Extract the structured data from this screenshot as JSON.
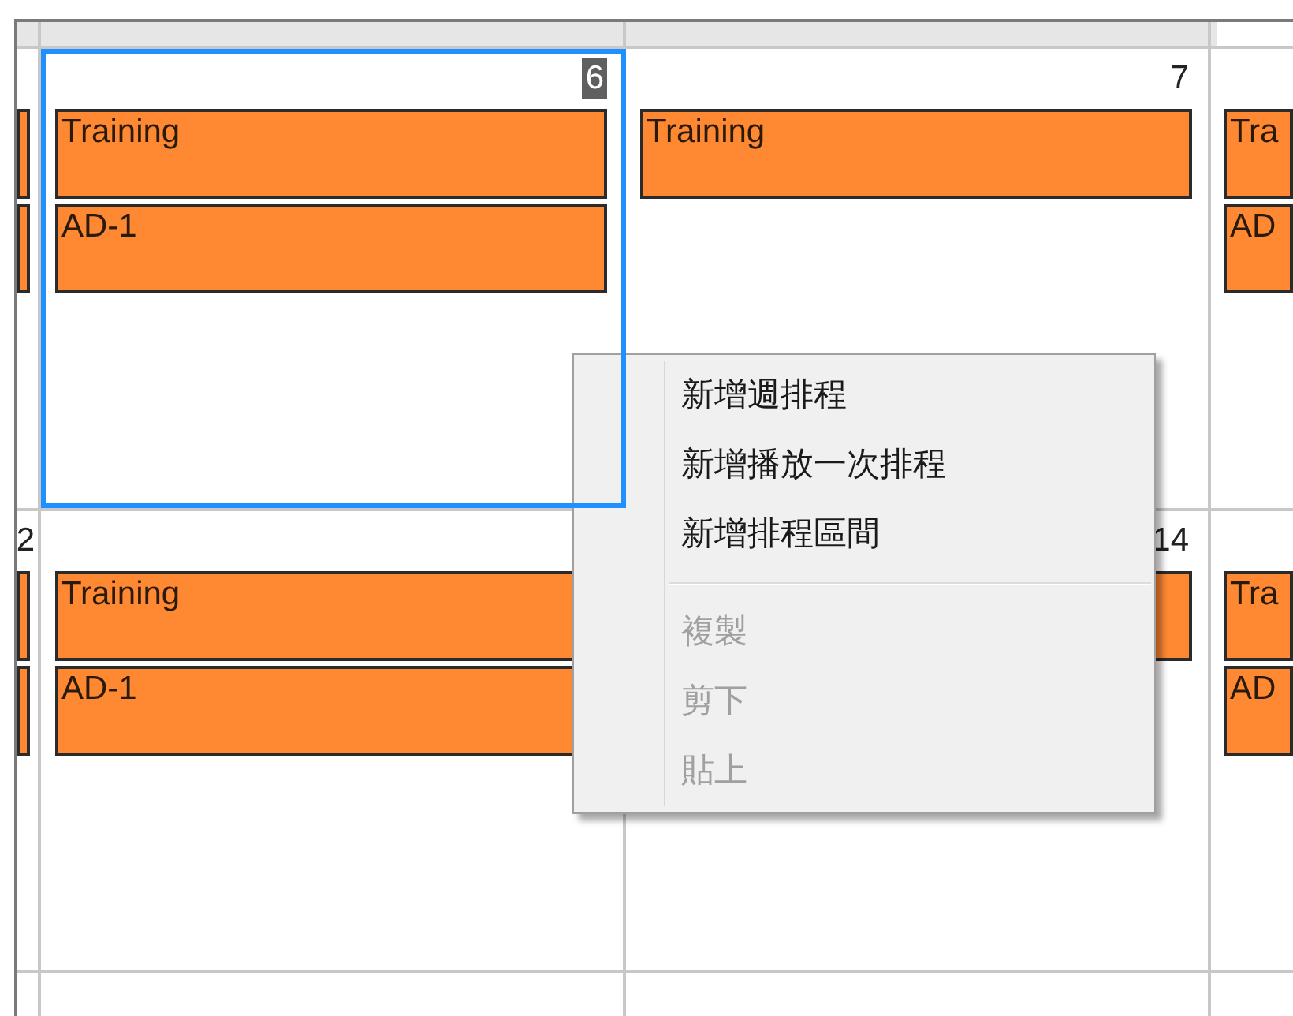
{
  "calendar": {
    "rows": [
      {
        "cells": [
          {
            "selected": false,
            "events": [
              {
                "kind": "bar"
              },
              {
                "kind": "bar"
              }
            ]
          },
          {
            "day": "6",
            "selected": true,
            "events": [
              {
                "title": "Training"
              },
              {
                "title": "AD-1"
              }
            ]
          },
          {
            "day": "7",
            "selected": false,
            "events": [
              {
                "title": "Training"
              }
            ]
          },
          {
            "selected": false,
            "events": [
              {
                "title": "Tra"
              },
              {
                "title": "AD"
              }
            ]
          }
        ]
      },
      {
        "cells": [
          {
            "day": "2",
            "selected": false,
            "events": [
              {
                "kind": "bar"
              },
              {
                "kind": "bar"
              }
            ]
          },
          {
            "selected": false,
            "events": [
              {
                "title": "Training"
              },
              {
                "title": "AD-1"
              }
            ]
          },
          {
            "day": "14",
            "selected": false,
            "events": [
              {
                "kind": "bar"
              }
            ]
          },
          {
            "selected": false,
            "events": [
              {
                "title": "Tra"
              },
              {
                "title": "AD"
              }
            ]
          }
        ]
      },
      {
        "cells": [
          {
            "selected": false
          },
          {
            "selected": false
          },
          {
            "selected": false
          },
          {
            "selected": false
          }
        ]
      }
    ]
  },
  "context_menu": {
    "items": [
      {
        "kind": "item",
        "label": "新增週排程",
        "disabled": false
      },
      {
        "kind": "item",
        "label": "新增播放一次排程",
        "disabled": false
      },
      {
        "kind": "item",
        "label": "新增排程區間",
        "disabled": false
      },
      {
        "kind": "separator"
      },
      {
        "kind": "item",
        "label": "複製",
        "disabled": true
      },
      {
        "kind": "item",
        "label": "剪下",
        "disabled": true
      },
      {
        "kind": "item",
        "label": "貼上",
        "disabled": true
      }
    ]
  }
}
